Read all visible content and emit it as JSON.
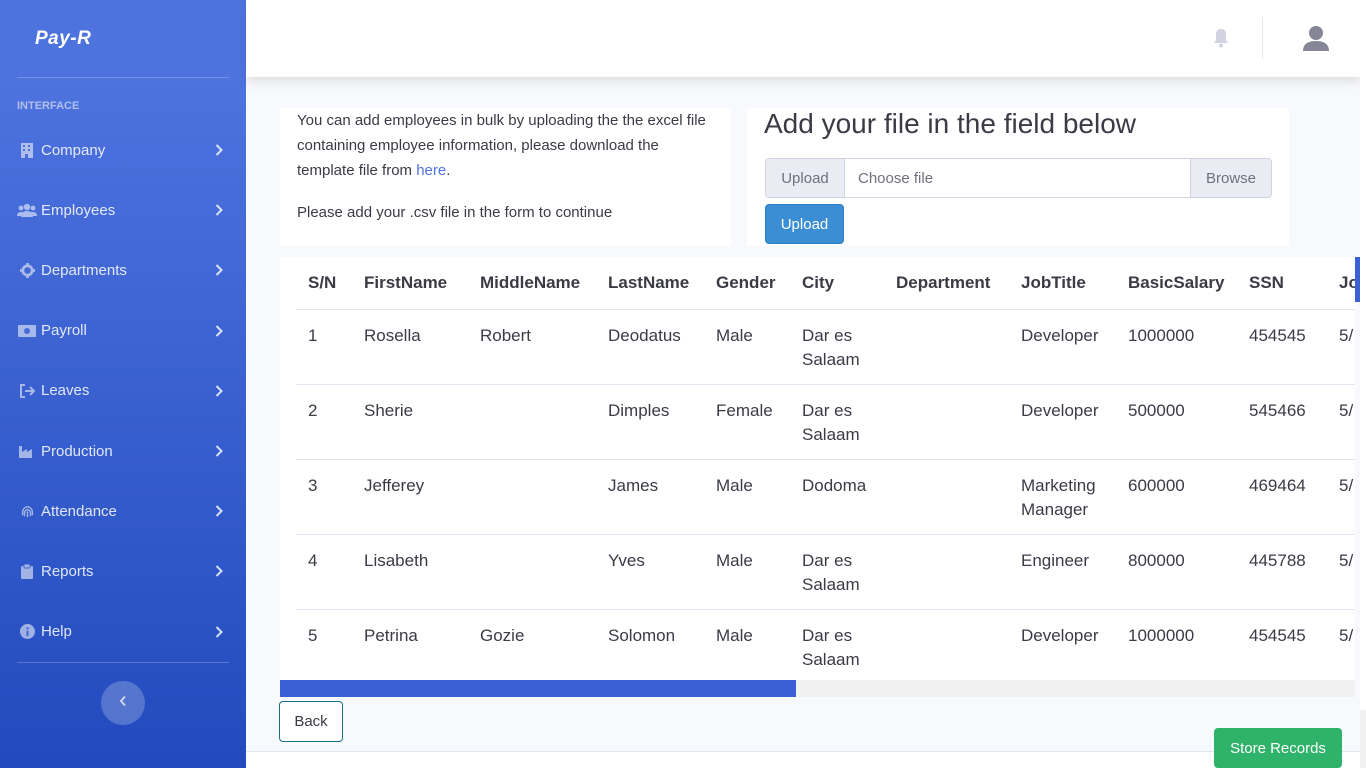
{
  "brand": "Pay-R",
  "sidebar": {
    "heading": "INTERFACE",
    "items": [
      {
        "label": "Company",
        "icon": "building-icon"
      },
      {
        "label": "Employees",
        "icon": "users-icon"
      },
      {
        "label": "Departments",
        "icon": "cog-icon"
      },
      {
        "label": "Payroll",
        "icon": "money-icon"
      },
      {
        "label": "Leaves",
        "icon": "sign-out-icon"
      },
      {
        "label": "Production",
        "icon": "industry-icon"
      },
      {
        "label": "Attendance",
        "icon": "fingerprint-icon"
      },
      {
        "label": "Reports",
        "icon": "clipboard-icon"
      },
      {
        "label": "Help",
        "icon": "info-icon"
      }
    ]
  },
  "info": {
    "text_before_link": "You can add employees in bulk by uploading the the excel file containing employee information, please download the template file from ",
    "link": "here",
    "text_after_link": ".",
    "instruction": "Please add your .csv file in the form to continue"
  },
  "upload": {
    "title": "Add your file in the field below",
    "prepend": "Upload",
    "placeholder": "Choose file",
    "browse": "Browse",
    "button": "Upload"
  },
  "table": {
    "headers": [
      "S/N",
      "FirstName",
      "MiddleName",
      "LastName",
      "Gender",
      "City",
      "Department",
      "JobTitle",
      "BasicSalary",
      "SSN",
      "Jo"
    ],
    "rows": [
      [
        "1",
        "Rosella",
        "Robert",
        "Deodatus",
        "Male",
        "Dar es Salaam",
        "",
        "Developer",
        "1000000",
        "454545",
        "5/"
      ],
      [
        "2",
        "Sherie",
        "",
        "Dimples",
        "Female",
        "Dar es Salaam",
        "",
        "Developer",
        "500000",
        "545466",
        "5/"
      ],
      [
        "3",
        "Jefferey",
        "",
        "James",
        "Male",
        "Dodoma",
        "",
        "Marketing Manager",
        "600000",
        "469464",
        "5/"
      ],
      [
        "4",
        "Lisabeth",
        "",
        "Yves",
        "Male",
        "Dar es Salaam",
        "",
        "Engineer",
        "800000",
        "445788",
        "5/"
      ],
      [
        "5",
        "Petrina",
        "Gozie",
        "Solomon",
        "Male",
        "Dar es Salaam",
        "",
        "Developer",
        "1000000",
        "454545",
        "5/"
      ]
    ]
  },
  "buttons": {
    "back": "Back",
    "store": "Store Records"
  },
  "colors": {
    "sidebar_start": "#4e73df",
    "sidebar_end": "#224abe",
    "upload_button": "#3b8ed4",
    "store_button": "#2fb36b",
    "link": "#4e73df"
  }
}
